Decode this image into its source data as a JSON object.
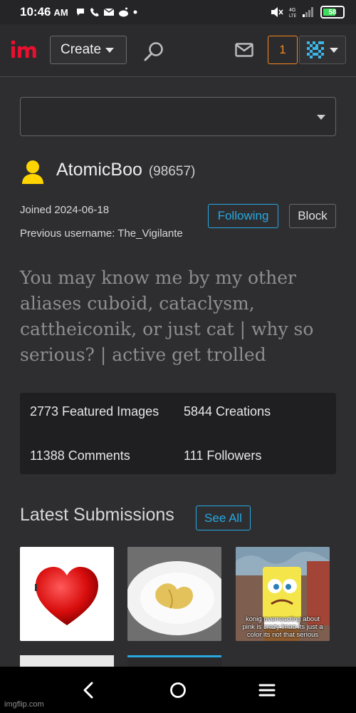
{
  "status_bar": {
    "time": "10:46",
    "ampm": "AM",
    "battery": "58"
  },
  "header": {
    "logo_text": "im",
    "create_label": "Create",
    "notification_count": "1"
  },
  "profile": {
    "username": "AtomicBoo",
    "points": "(98657)",
    "joined": "Joined 2024-06-18",
    "previous_username": "Previous username: The_Vigilante",
    "following_label": "Following",
    "block_label": "Block",
    "bio": "You may know me by my other aliases cuboid, cataclysm, cattheiconik, or just cat | why so serious? | active get trolled"
  },
  "stats": {
    "featured": "2773 Featured Images",
    "creations": "5844 Creations",
    "comments": "11388 Comments",
    "followers": "111 Followers"
  },
  "submissions": {
    "title": "Latest Submissions",
    "see_all_label": "See All",
    "meme_caption": "konig overreacting about pink is crazy lmao its just a color its not that serious"
  },
  "watermark": "imgflip.com",
  "colors": {
    "accent_blue": "#28a8e0",
    "notif_orange": "#f5871f",
    "logo_red": "#e8102f",
    "user_icon_yellow": "#ffd400"
  }
}
